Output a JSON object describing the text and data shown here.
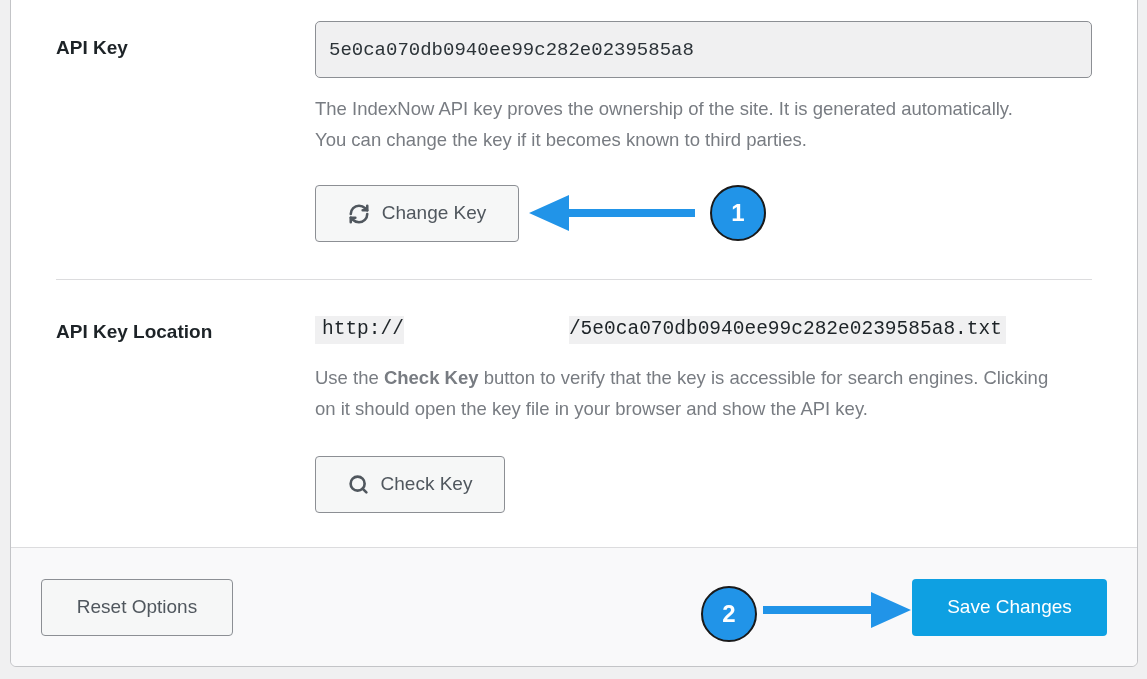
{
  "api_key": {
    "label": "API Key",
    "value": "5e0ca070db0940ee99c282e0239585a8",
    "description": "The IndexNow API key proves the ownership of the site. It is generated automatically. You can change the key if it becomes known to third parties.",
    "button": "Change Key"
  },
  "api_key_location": {
    "label": "API Key Location",
    "url_start": "http://",
    "url_end": "/5e0ca070db0940ee99c282e0239585a8.txt",
    "description": "Use the **Check Key** button to verify that the key is accessible for search engines. Clicking on it should open the key file in your browser and show the API key.",
    "button": "Check Key"
  },
  "footer": {
    "reset_button": "Reset Options",
    "save_button": "Save Changes"
  },
  "annotations": [
    {
      "number": "1"
    },
    {
      "number": "2"
    }
  ]
}
